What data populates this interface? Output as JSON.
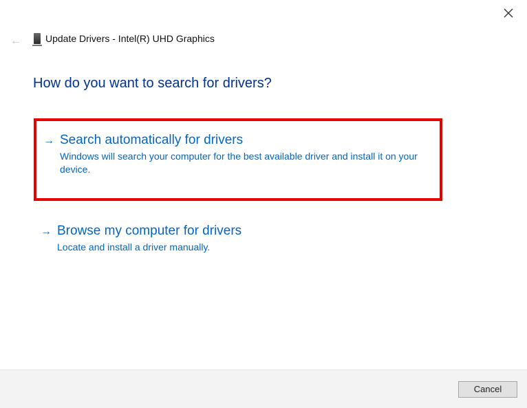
{
  "window": {
    "title": "Update Drivers - Intel(R) UHD Graphics"
  },
  "heading": "How do you want to search for drivers?",
  "options": {
    "search_auto": {
      "title": "Search automatically for drivers",
      "description": "Windows will search your computer for the best available driver and install it on your device."
    },
    "browse": {
      "title": "Browse my computer for drivers",
      "description": "Locate and install a driver manually."
    }
  },
  "footer": {
    "cancel_label": "Cancel"
  }
}
